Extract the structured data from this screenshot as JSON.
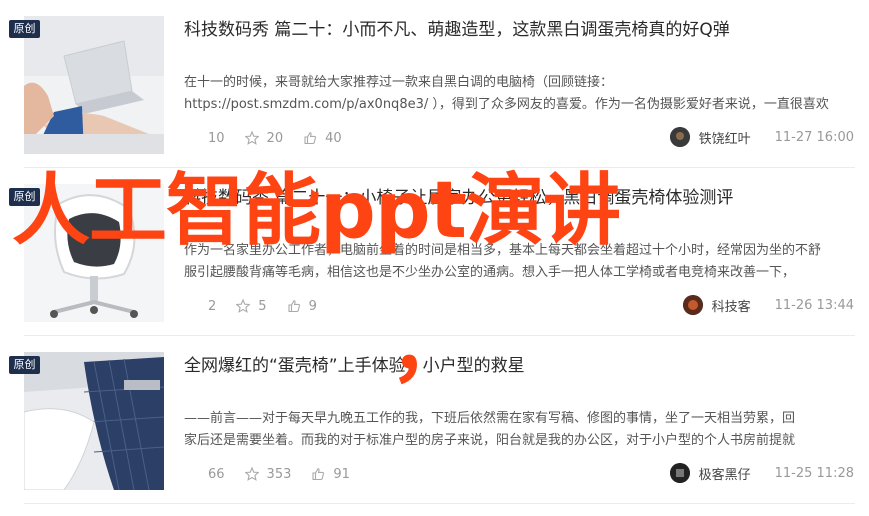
{
  "badge_label": "原创",
  "articles": [
    {
      "title": "科技数码秀 篇二十：小而不凡、萌趣造型，这款黑白调蛋壳椅真的好Q弹",
      "summary_line1": "在十一的时候，来哥就给大家推荐过一款来自黑白调的电脑椅（回顾链接：",
      "summary_line2": "https://post.smzdm.com/p/ax0nq8e3/ ），得到了众多网友的喜爱。作为一名伪摄影爱好者来说，一直很喜欢",
      "comments": "10",
      "favorites": "20",
      "likes": "40",
      "author": "铁饶红叶",
      "time": "11-27 16:00"
    },
    {
      "title": "科技数码秀 篇二十一：小椅子让居家办公更轻松，黑白调蛋壳椅体验测评",
      "summary_line1": "作为一名家里办公工作者，电脑前坐着的时间是相当多，基本上每天都会坐着超过十个小时，经常因为坐的不舒",
      "summary_line2": "服引起腰酸背痛等毛病，相信这也是不少坐办公室的通病。想入手一把人体工学椅或者电竞椅来改善一下，",
      "comments": "2",
      "favorites": "5",
      "likes": "9",
      "author": "科技客",
      "time": "11-26 13:44"
    },
    {
      "title": "全网爆红的“蛋壳椅”上手体验，小户型的救星",
      "summary_line1": "——前言——对于每天早九晚五工作的我，下班后依然需在家有写稿、修图的事情，坐了一天相当劳累，回",
      "summary_line2": "家后还是需要坐着。而我的对于标准户型的房子来说，阳台就是我的办公区，对于小户型的个人书房前提就",
      "comments": "66",
      "favorites": "353",
      "likes": "91",
      "author": "极客黑仔",
      "time": "11-25 11:28"
    }
  ],
  "overlay_text": "人工智能ppt演讲",
  "overlay_text2": "，",
  "icons": {
    "comment": "comment-icon",
    "favorite": "star-icon",
    "like": "thumbs-up-icon"
  },
  "colors": {
    "badge_bg": "#1e2f4e",
    "overlay": "#ff4414",
    "meta_gray": "#999999"
  }
}
